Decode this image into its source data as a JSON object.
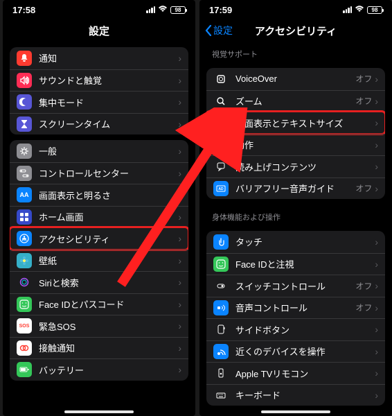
{
  "left": {
    "time": "17:58",
    "battery": "98",
    "title": "設定",
    "group1": [
      {
        "label": "通知",
        "iconBg": "#ff3b30",
        "svg": "bell"
      },
      {
        "label": "サウンドと触覚",
        "iconBg": "#ff2d55",
        "svg": "sound"
      },
      {
        "label": "集中モード",
        "iconBg": "#5856d6",
        "svg": "moon"
      },
      {
        "label": "スクリーンタイム",
        "iconBg": "#5856d6",
        "svg": "hourglass"
      }
    ],
    "group2": [
      {
        "label": "一般",
        "iconBg": "#8e8e93",
        "svg": "gear"
      },
      {
        "label": "コントロールセンター",
        "iconBg": "#8e8e93",
        "svg": "switches"
      },
      {
        "label": "画面表示と明るさ",
        "iconBg": "#0a84ff",
        "svg": "aa"
      },
      {
        "label": "ホーム画面",
        "iconBg": "#3549c9",
        "svg": "grid"
      },
      {
        "label": "アクセシビリティ",
        "iconBg": "#0a84ff",
        "svg": "person",
        "highlight": true
      },
      {
        "label": "壁紙",
        "iconBg": "#36b0c9",
        "svg": "flower"
      },
      {
        "label": "Siriと検索",
        "iconBg": "#1c1c1e",
        "svg": "siri"
      },
      {
        "label": "Face IDとパスコード",
        "iconBg": "#34c759",
        "svg": "face"
      },
      {
        "label": "緊急SOS",
        "iconBg": "#fff",
        "text": "SOS",
        "textColor": "#ff3b30"
      },
      {
        "label": "接触通知",
        "iconBg": "#fff",
        "svg": "exposure"
      },
      {
        "label": "バッテリー",
        "iconBg": "#34c759",
        "svg": "battery"
      }
    ]
  },
  "right": {
    "time": "17:59",
    "battery": "98",
    "back": "設定",
    "title": "アクセシビリティ",
    "sec1_header": "視覚サポート",
    "sec1": [
      {
        "label": "VoiceOver",
        "value": "オフ",
        "iconBg": "#1c1c1e",
        "svg": "vo"
      },
      {
        "label": "ズーム",
        "value": "オフ",
        "iconBg": "#1c1c1e",
        "svg": "zoom"
      },
      {
        "label": "画面表示とテキストサイズ",
        "iconBg": "#0a84ff",
        "svg": "aa",
        "highlight": true
      },
      {
        "label": "動作",
        "iconBg": "#34c759",
        "svg": "motion"
      },
      {
        "label": "読み上げコンテンツ",
        "iconBg": "#1c1c1e",
        "svg": "speech"
      },
      {
        "label": "バリアフリー音声ガイド",
        "value": "オフ",
        "iconBg": "#0a84ff",
        "svg": "ad"
      }
    ],
    "sec2_header": "身体機能および操作",
    "sec2": [
      {
        "label": "タッチ",
        "iconBg": "#0a84ff",
        "svg": "touch"
      },
      {
        "label": "Face IDと注視",
        "iconBg": "#34c759",
        "svg": "face"
      },
      {
        "label": "スイッチコントロール",
        "value": "オフ",
        "iconBg": "#1c1c1e",
        "svg": "switch"
      },
      {
        "label": "音声コントロール",
        "value": "オフ",
        "iconBg": "#0a84ff",
        "svg": "voice"
      },
      {
        "label": "サイドボタン",
        "iconBg": "#1c1c1e",
        "svg": "side"
      },
      {
        "label": "近くのデバイスを操作",
        "iconBg": "#0a84ff",
        "svg": "nearby"
      },
      {
        "label": "Apple TVリモコン",
        "iconBg": "#1c1c1e",
        "svg": "remote"
      },
      {
        "label": "キーボード",
        "iconBg": "#1c1c1e",
        "svg": "keyboard"
      }
    ]
  }
}
